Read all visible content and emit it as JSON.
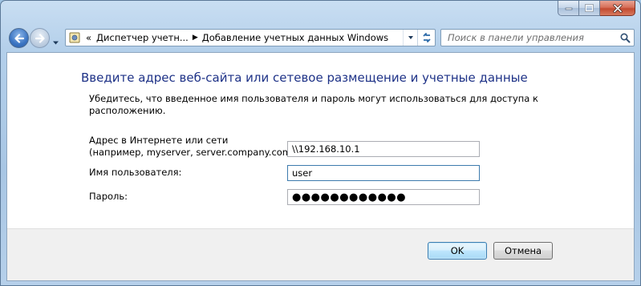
{
  "window": {
    "caption_buttons": [
      "minimize-icon",
      "maximize-icon",
      "close-icon"
    ]
  },
  "navigation": {
    "back_icon": "back-arrow-icon",
    "forward_icon": "forward-arrow-icon",
    "history_icon": "chevron-down-icon"
  },
  "address_bar": {
    "overflow": "«",
    "crumbs": [
      "Диспетчер учетн...",
      "Добавление учетных данных Windows"
    ],
    "separator": "▶",
    "icon": "control-panel-icon"
  },
  "search": {
    "placeholder": "Поиск в панели управления",
    "icon": "search-icon"
  },
  "form": {
    "heading": "Введите адрес веб-сайта или сетевое размещение и учетные данные",
    "description": "Убедитесь, что введенное имя пользователя и пароль могут использоваться для доступа к расположению.",
    "address": {
      "label_line1": "Адрес в Интернете или сети",
      "label_line2": "(например, myserver, server.company.com):",
      "value": "\\\\192.168.10.1"
    },
    "username": {
      "label": "Имя пользователя:",
      "value": "user"
    },
    "password": {
      "label": "Пароль:",
      "value": "●●●●●●●●●●●●"
    }
  },
  "buttons": {
    "ok": "OK",
    "cancel": "Отмена"
  },
  "colors": {
    "heading": "#1e3287",
    "frame": "#a8c6e4",
    "close_button": "#c24a30"
  }
}
